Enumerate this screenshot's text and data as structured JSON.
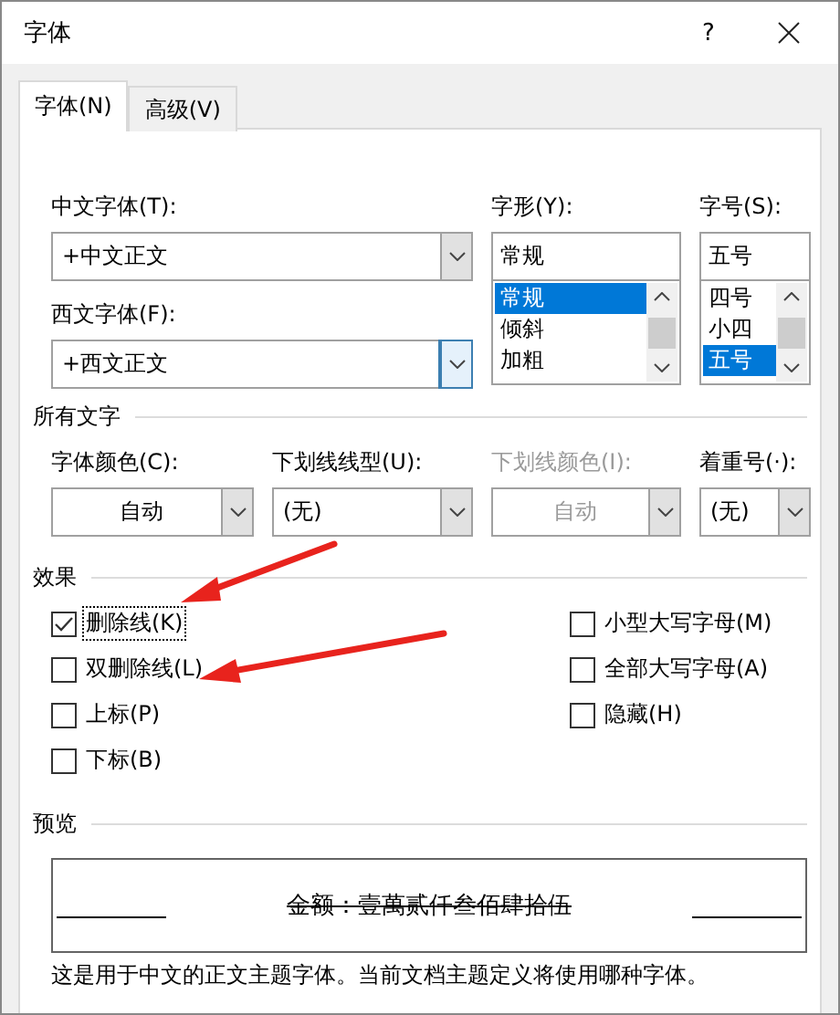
{
  "window": {
    "title": "字体",
    "help": "?"
  },
  "tabs": [
    {
      "label": "字体(N)",
      "selected": true
    },
    {
      "label": "高级(V)",
      "selected": false
    }
  ],
  "font": {
    "chinese_label": "中文字体(T):",
    "chinese_value": "+中文正文",
    "western_label": "西文字体(F):",
    "western_value": "+西文正文",
    "western_hovered": true,
    "style_label": "字形(Y):",
    "style_value": "常规",
    "styles": [
      {
        "label": "常规",
        "selected": true
      },
      {
        "label": "倾斜",
        "selected": false
      },
      {
        "label": "加粗",
        "selected": false
      }
    ],
    "size_label": "字号(S):",
    "size_value": "五号",
    "sizes": [
      {
        "label": "四号",
        "selected": false
      },
      {
        "label": "小四",
        "selected": false
      },
      {
        "label": "五号",
        "selected": true
      }
    ]
  },
  "all_text": {
    "heading": "所有文字",
    "fields": [
      {
        "label": "字体颜色(C):",
        "value": "自动",
        "kind": "color",
        "disabled": false
      },
      {
        "label": "下划线线型(U):",
        "value": "(无)",
        "kind": "style",
        "disabled": false
      },
      {
        "label": "下划线颜色(I):",
        "value": "自动",
        "kind": "color",
        "disabled": true
      },
      {
        "label": "着重号(·):",
        "value": "(无)",
        "kind": "style",
        "disabled": false
      }
    ]
  },
  "effects": {
    "heading": "效果",
    "left": [
      {
        "label": "删除线(K)",
        "checked": true,
        "focused": true
      },
      {
        "label": "双删除线(L)",
        "checked": false,
        "focused": false
      },
      {
        "label": "上标(P)",
        "checked": false,
        "focused": false
      },
      {
        "label": "下标(B)",
        "checked": false,
        "focused": false
      }
    ],
    "right": [
      {
        "label": "小型大写字母(M)",
        "checked": false,
        "focused": false
      },
      {
        "label": "全部大写字母(A)",
        "checked": false,
        "focused": false
      },
      {
        "label": "隐藏(H)",
        "checked": false,
        "focused": false
      }
    ]
  },
  "preview": {
    "heading": "预览",
    "sample": "金额：壹萬贰仟叁佰肆拾伍",
    "strikethrough": true,
    "description": "这是用于中文的正文主题字体。当前文档主题定义将使用哪种字体。"
  }
}
